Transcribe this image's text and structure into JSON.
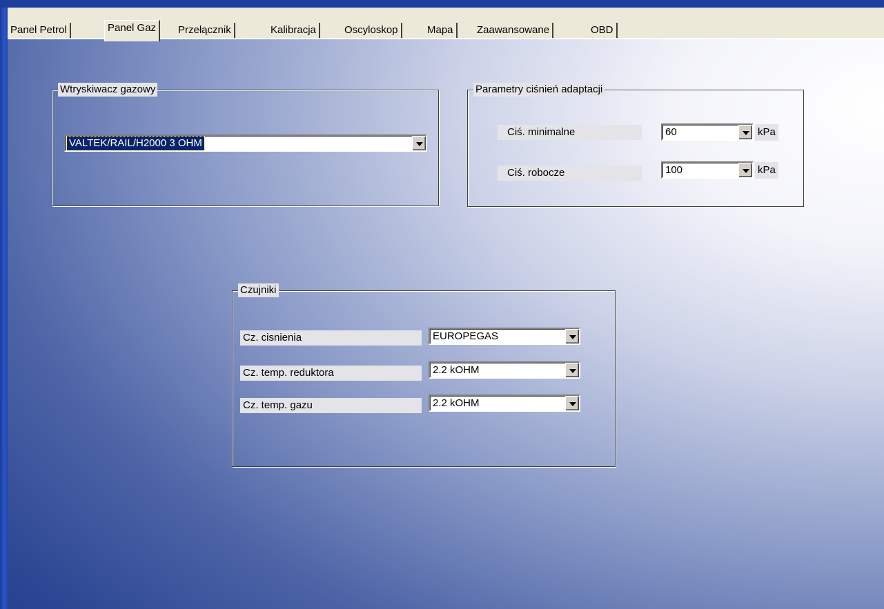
{
  "tabs": [
    {
      "label": "Panel Petrol"
    },
    {
      "label": "Panel Gaz"
    },
    {
      "label": "Przełącznik"
    },
    {
      "label": "Kalibracja"
    },
    {
      "label": "Oscyloskop"
    },
    {
      "label": "Mapa"
    },
    {
      "label": "Zaawansowane"
    },
    {
      "label": "OBD"
    }
  ],
  "active_tab": "Panel Gaz",
  "injector_group": {
    "title": "Wtryskiwacz gazowy",
    "selected": "VALTEK/RAIL/H2000 3 OHM"
  },
  "pressure_group": {
    "title": "Parametry ciśnień adaptacji",
    "rows": [
      {
        "label": "Ciś. minimalne",
        "value": "60",
        "unit": "kPa"
      },
      {
        "label": "Ciś. robocze",
        "value": "100",
        "unit": "kPa"
      }
    ]
  },
  "sensors_group": {
    "title": "Czujniki",
    "rows": [
      {
        "label": "Cz. cisnienia",
        "value": "EUROPEGAS"
      },
      {
        "label": "Cz. temp. reduktora",
        "value": "2.2 kOHM"
      },
      {
        "label": "Cz. temp. gazu",
        "value": "2.2 kOHM"
      }
    ]
  },
  "colors": {
    "selection": "#0a246a",
    "tabbar": "#ece9d8",
    "window_frame": "#1c3f9e"
  }
}
